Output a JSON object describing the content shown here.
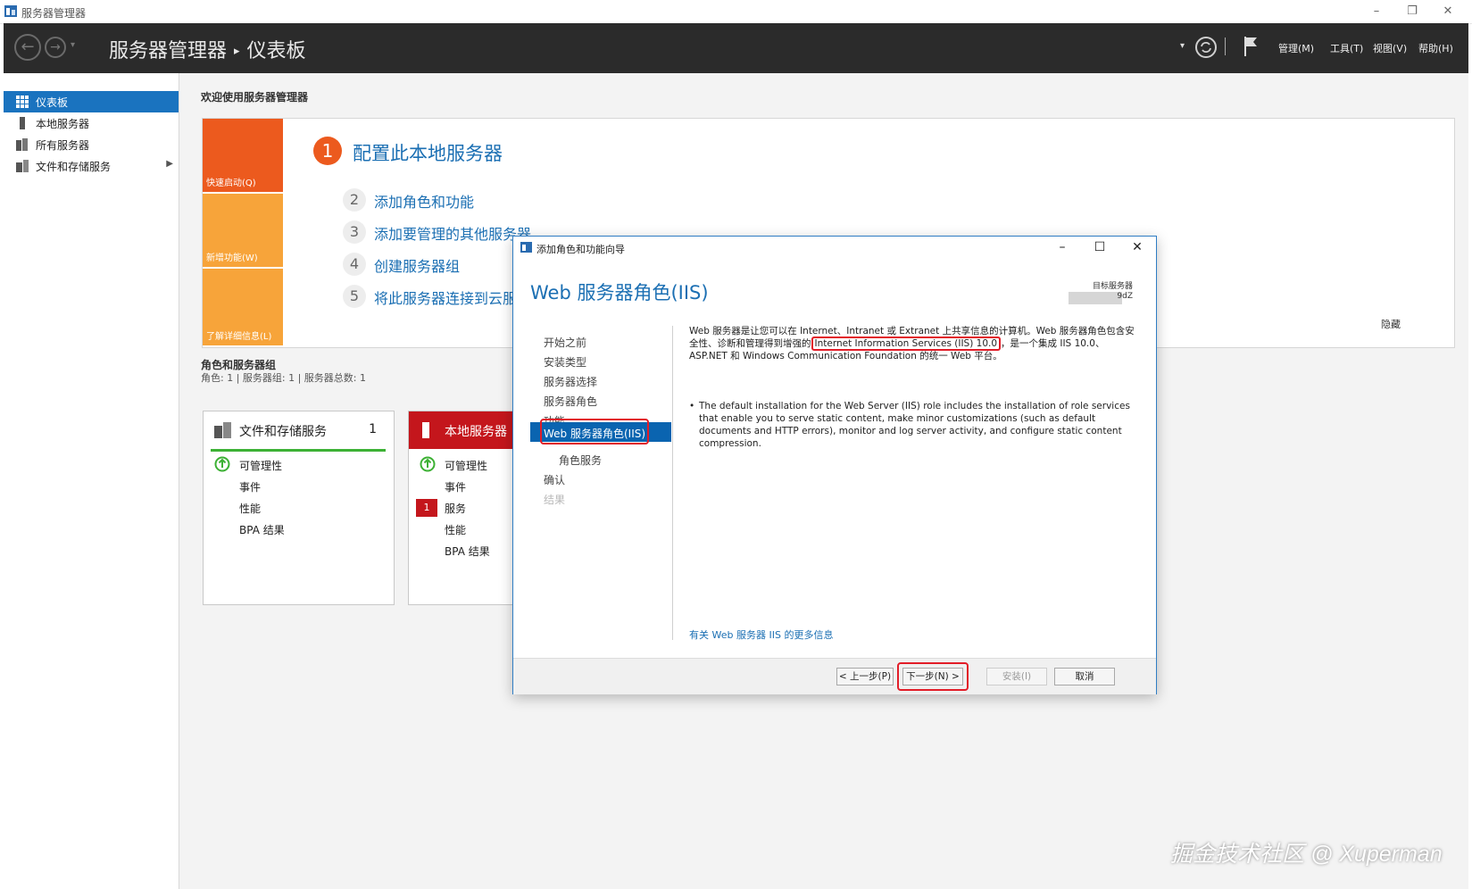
{
  "window": {
    "title": "服务器管理器",
    "controls": [
      "minimize-icon",
      "restore-icon",
      "close-icon"
    ]
  },
  "header": {
    "breadcrumb_app": "服务器管理器",
    "breadcrumb_sep": "▸",
    "breadcrumb_page": "仪表板",
    "menus": [
      "管理(M)",
      "工具(T)",
      "视图(V)",
      "帮助(H)"
    ]
  },
  "sidebar": {
    "items": [
      {
        "label": "仪表板",
        "icon": "dashboard-icon",
        "active": true
      },
      {
        "label": "本地服务器",
        "icon": "server-icon"
      },
      {
        "label": "所有服务器",
        "icon": "servers-icon"
      },
      {
        "label": "文件和存储服务",
        "icon": "storage-icon"
      }
    ]
  },
  "main": {
    "welcome": "欢迎使用服务器管理器",
    "tiles": [
      "快速启动(Q)",
      "新增功能(W)",
      "了解详细信息(L)"
    ],
    "step1_num": "1",
    "step1_title": "配置此本地服务器",
    "steps": [
      {
        "num": "2",
        "text": "添加角色和功能"
      },
      {
        "num": "3",
        "text": "添加要管理的其他服务器"
      },
      {
        "num": "4",
        "text": "创建服务器组"
      },
      {
        "num": "5",
        "text": "将此服务器连接到云服务"
      }
    ],
    "hide": "隐藏",
    "roles_title": "角色和服务器组",
    "roles_sub": "角色: 1 | 服务器组: 1 | 服务器总数: 1",
    "cards": [
      {
        "name": "文件和存储服务",
        "count": "1",
        "rows": [
          "可管理性",
          "事件",
          "性能",
          "BPA 结果"
        ]
      },
      {
        "name": "本地服务器",
        "rows": [
          "可管理性",
          "事件",
          "服务",
          "性能",
          "BPA 结果"
        ],
        "badge": "1"
      }
    ]
  },
  "dialog": {
    "title": "添加角色和功能向导",
    "heading": "Web 服务器角色(IIS)",
    "target_label": "目标服务器",
    "target_value": "9dZ",
    "nav": [
      "开始之前",
      "安装类型",
      "服务器选择",
      "服务器角色",
      "功能",
      "Web 服务器角色(IIS)",
      "角色服务",
      "确认",
      "结果"
    ],
    "desc_pre": "Web 服务器是让您可以在 Internet、Intranet 或 Extranet 上共享信息的计算机。Web 服务器角色包含安全性、诊断和管理得到增强的",
    "desc_highlight": "Internet Information Services (IIS) 10.0",
    "desc_post": "，是一个集成 IIS 10.0、ASP.NET 和 Windows Communication Foundation 的统一 Web 平台。",
    "bullet": "The default installation for the Web Server (IIS) role includes the installation of role services that enable you to serve static content, make minor customizations (such as default documents and HTTP errors), monitor and log server activity, and configure static content compression.",
    "more_link": "有关 Web 服务器 IIS 的更多信息",
    "buttons": {
      "prev": "< 上一步(P)",
      "next": "下一步(N) >",
      "install": "安装(I)",
      "cancel": "取消"
    }
  },
  "watermark": "掘金技术社区 @ Xuperman",
  "colors": {
    "accent": "#1a73bf",
    "orange_dark": "#ec5a1e",
    "orange_light": "#f7a43a",
    "red": "#c4161c",
    "header_bg": "#2b2b2b"
  }
}
